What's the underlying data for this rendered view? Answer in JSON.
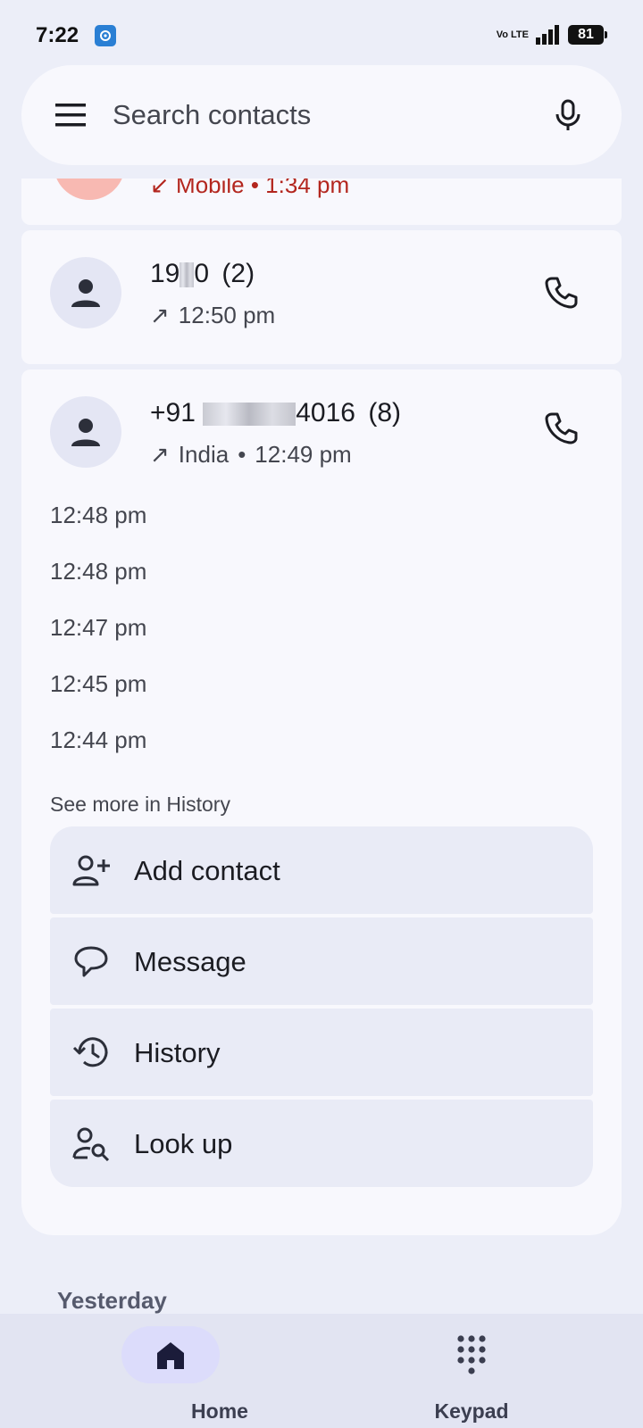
{
  "status_bar": {
    "time": "7:22",
    "network": "Vo LTE",
    "battery": "81"
  },
  "search": {
    "placeholder": "Search contacts"
  },
  "partial_entry": {
    "meta": "Mobile • 1:34 pm"
  },
  "entries": [
    {
      "name_prefix": "19",
      "name_suffix": "0",
      "count": "(2)",
      "time": "12:50 pm"
    },
    {
      "name_prefix": "+91",
      "name_suffix": "4016",
      "count": "(8)",
      "location": "India",
      "separator": "•",
      "time": "12:49 pm",
      "history_times": [
        "12:48 pm",
        "12:48 pm",
        "12:47 pm",
        "12:45 pm",
        "12:44 pm"
      ],
      "see_more": "See more in History",
      "actions": [
        {
          "label": "Add contact",
          "icon": "add-contact-icon"
        },
        {
          "label": "Message",
          "icon": "message-icon"
        },
        {
          "label": "History",
          "icon": "history-icon"
        },
        {
          "label": "Look up",
          "icon": "look-up-icon"
        }
      ]
    }
  ],
  "section": {
    "yesterday": "Yesterday"
  },
  "nav": {
    "home": "Home",
    "keypad": "Keypad"
  },
  "colors": {
    "background": "#eceef8",
    "card": "#f8f8fd",
    "missed_call": "#b3261e",
    "active_nav": "#dcdcfb"
  }
}
